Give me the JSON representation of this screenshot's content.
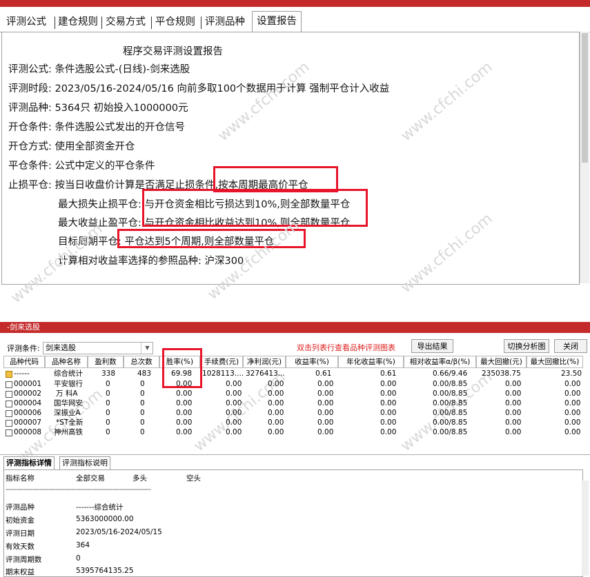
{
  "top_tabs": [
    "评测公式",
    "建仓规则",
    "交易方式",
    "平仓规则",
    "评测品种",
    "设置报告"
  ],
  "report": {
    "title": "程序交易评测设置报告",
    "lines": [
      "评测公式: 条件选股公式-(日线)-剑来选股",
      "评测时段: 2023/05/16-2024/05/16 向前多取100个数据用于计算 强制平仓计入收益",
      "评测品种: 5364只 初始投入1000000元",
      "开仓条件: 条件选股公式发出的开仓信号",
      "开仓方式: 使用全部资金开仓",
      "平仓条件: 公式中定义的平仓条件",
      "止损平仓: 按当日收盘价计算是否满足止损条件,按本周期最高价平仓",
      "最大损失止损平仓: 与开仓资金相比亏损达到10%,则全部数量平仓",
      "最大收益止盈平仓: 与开仓资金相比收益达到10%,则全部数量平仓",
      "目标周期平仓: 平仓达到5个周期,则全部数量平仓",
      "计算相对收益率选择的参照品种: 沪深300"
    ]
  },
  "watermark": "www.cfchi.com",
  "bottom": {
    "window_title": "-剑来选股",
    "cond_label": "评测条件:",
    "cond_value": "剑来选股",
    "hint": "双击列表行查看品种评测图表",
    "export_btn": "导出结果",
    "switch_btn": "切换分析图",
    "close_btn": "关闭",
    "columns": [
      "品种代码",
      "品种名称",
      "盈利数",
      "总次数",
      "胜率(%)",
      "手续费(元)",
      "净利润(元)",
      "收益率(%)",
      "年化收益率(%)",
      "相对收益率α/β(%)",
      "最大回撤(元)",
      "最大回撤比(%)"
    ],
    "rows": [
      [
        "------",
        "综合统计",
        "338",
        "483",
        "69.98",
        "1028113....",
        "3276413...",
        "0.61",
        "0.61",
        "0.66/9.46",
        "235038.75",
        "23.50"
      ],
      [
        "000001",
        "平安银行",
        "0",
        "0",
        "0.00",
        "0.00",
        "0.00",
        "0.00",
        "0.00",
        "0.00/8.85",
        "0.00",
        "0.00"
      ],
      [
        "000002",
        "万 科A",
        "0",
        "0",
        "0.00",
        "0.00",
        "0.00",
        "0.00",
        "0.00",
        "0.00/8.85",
        "0.00",
        "0.00"
      ],
      [
        "000004",
        "国华网安",
        "0",
        "0",
        "0.00",
        "0.00",
        "0.00",
        "0.00",
        "0.00",
        "0.00/8.85",
        "0.00",
        "0.00"
      ],
      [
        "000006",
        "深振业A",
        "0",
        "0",
        "0.00",
        "0.00",
        "0.00",
        "0.00",
        "0.00",
        "0.00/8.85",
        "0.00",
        "0.00"
      ],
      [
        "000007",
        "*ST全新",
        "0",
        "0",
        "0.00",
        "0.00",
        "0.00",
        "0.00",
        "0.00",
        "0.00/8.85",
        "0.00",
        "0.00"
      ],
      [
        "000008",
        "神州高铁",
        "0",
        "0",
        "0.00",
        "0.00",
        "0.00",
        "0.00",
        "0.00",
        "0.00/8.85",
        "0.00",
        "0.00"
      ]
    ],
    "detail_tabs": [
      "评测指标详情",
      "评测指标说明"
    ],
    "detail_header": [
      "指标名称",
      "全部交易",
      "多头",
      "空头"
    ],
    "detail_divider": "----------------------------------------------------------------",
    "detail_rows": [
      [
        "评测品种",
        "-------综合统计"
      ],
      [
        "初始资金",
        "5363000000.00"
      ],
      [
        "评测日期",
        "2023/05/16-2024/05/15"
      ],
      [
        "有效天数",
        "364"
      ],
      [
        "评测周期数",
        "0"
      ],
      [
        "期末权益",
        "5395764135.25"
      ]
    ]
  }
}
